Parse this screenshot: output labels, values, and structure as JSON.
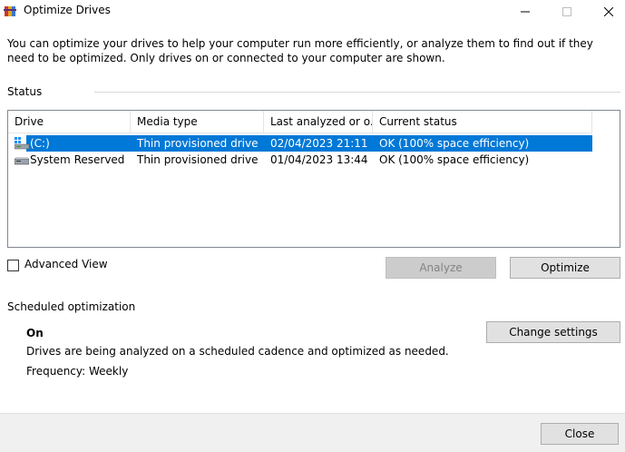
{
  "window": {
    "title": "Optimize Drives",
    "icon": "defrag-app-icon"
  },
  "intro_text": "You can optimize your drives to help your computer run more efficiently, or analyze them to find out if they need to be optimized. Only drives on or connected to your computer are shown.",
  "status": {
    "section_label": "Status",
    "columns": {
      "drive": "Drive",
      "media_type": "Media type",
      "last_analyzed": "Last analyzed or o...",
      "current_status": "Current status"
    },
    "rows": [
      {
        "drive": "(C:)",
        "media_type": "Thin provisioned drive",
        "last_analyzed": "02/04/2023 21:11",
        "current_status": "OK (100% space efficiency)",
        "icon": "windows-drive-icon",
        "selected": true
      },
      {
        "drive": "System Reserved",
        "media_type": "Thin provisioned drive",
        "last_analyzed": "01/04/2023 13:44",
        "current_status": "OK (100% space efficiency)",
        "icon": "drive-icon",
        "selected": false
      }
    ]
  },
  "advanced_view": {
    "label": "Advanced View",
    "checked": false
  },
  "buttons": {
    "analyze": "Analyze",
    "optimize": "Optimize",
    "change_settings": "Change settings",
    "close": "Close"
  },
  "scheduled": {
    "section_label": "Scheduled optimization",
    "state": "On",
    "description": "Drives are being analyzed on a scheduled cadence and optimized as needed.",
    "frequency": "Frequency: Weekly"
  },
  "colors": {
    "selection": "#0078d7",
    "footer_bg": "#f0f0f0",
    "button_bg": "#e1e1e1"
  }
}
